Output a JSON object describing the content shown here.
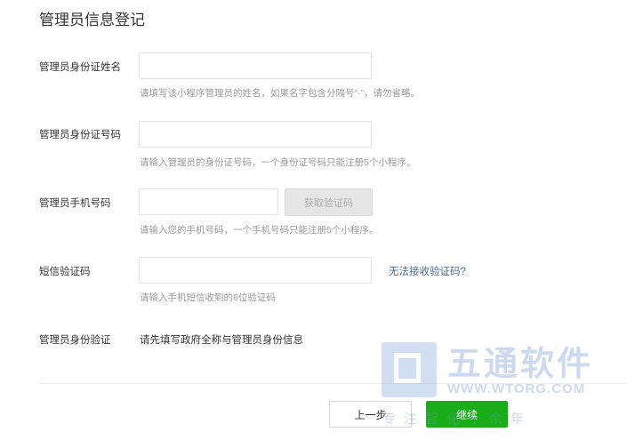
{
  "page": {
    "title": "管理员信息登记"
  },
  "form": {
    "name": {
      "label": "管理员身份证姓名",
      "value": "",
      "hint": "请填写该小程序管理员的姓名，如果名字包含分隔号“·”，请勿省略。"
    },
    "id_number": {
      "label": "管理员身份证号码",
      "value": "",
      "hint": "请输入管理员的身份证号码，一个身份证号码只能注册5个小程序。"
    },
    "phone": {
      "label": "管理员手机号码",
      "value": "",
      "get_code_button": "获取验证码",
      "hint": "请输入您的手机号码，一个手机号码只能注册5个小程序。"
    },
    "sms_code": {
      "label": "短信验证码",
      "value": "",
      "cannot_receive_link": "无法接收验证码?",
      "hint": "请输入手机短信收到的6位验证码"
    },
    "identity_verify": {
      "label": "管理员身份验证",
      "text": "请先填写政府全称与管理员身份信息"
    }
  },
  "footer": {
    "prev_button": "上一步",
    "next_button": "继续"
  },
  "watermark": {
    "name": "五通软件",
    "url": "WWW.WTORG.COM",
    "slogan": "专注智化十余年"
  },
  "colors": {
    "primary_green": "#1aad19",
    "link_blue": "#466a9d",
    "hint_gray": "#999999",
    "disabled_button": "#e6e6e6"
  }
}
